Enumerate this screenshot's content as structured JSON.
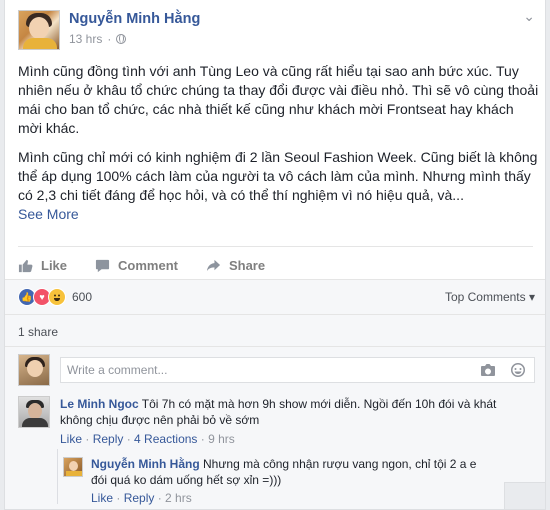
{
  "post": {
    "author": "Nguyễn Minh Hằng",
    "time": "13 hrs",
    "paragraph1": "Mình cũng đồng tình với anh Tùng Leo và cũng rất hiểu tại sao anh bức xúc. Tuy nhiên nếu ở khâu tổ chức chúng ta thay đổi được vài điều nhỏ. Thì sẽ vô cùng thoải mái cho ban tổ chức, các nhà thiết kế cũng như khách mời Frontseat hay khách mời khác.",
    "paragraph2": "Mình cũng chỉ mới có kinh nghiệm đi 2 lần Seoul Fashion Week. Cũng biết là không thể áp dụng 100% cách làm của người ta vô cách làm của mình. Nhưng mình thấy có 2,3 chi tiết đáng để học hỏi, và có thể thí nghiệm vì nó hiệu quả, và...",
    "see_more": "See More"
  },
  "actions": {
    "like": "Like",
    "comment": "Comment",
    "share": "Share"
  },
  "reactions": {
    "count": "600",
    "top_comments": "Top Comments ▾",
    "types": [
      "like",
      "love",
      "haha"
    ]
  },
  "shares": "1 share",
  "comment_box": {
    "placeholder": "Write a comment..."
  },
  "comments": [
    {
      "name": "Le Minh Ngoc",
      "text": "Tôi 7h có mặt mà hơn 9h show mới diễn. Ngồi đến 10h đói và khát không chịu được nên phải bỏ về sớm",
      "like": "Like",
      "reply": "Reply",
      "reactions": "4 Reactions",
      "time": "9 hrs"
    },
    {
      "name": "Nguyễn Minh Hằng",
      "text": "Nhưng mà công nhận rượu vang ngon, chỉ tội 2 a e đói quá ko dám uống hết sợ xỉn =)))",
      "like": "Like",
      "reply": "Reply",
      "time": "2 hrs"
    }
  ]
}
